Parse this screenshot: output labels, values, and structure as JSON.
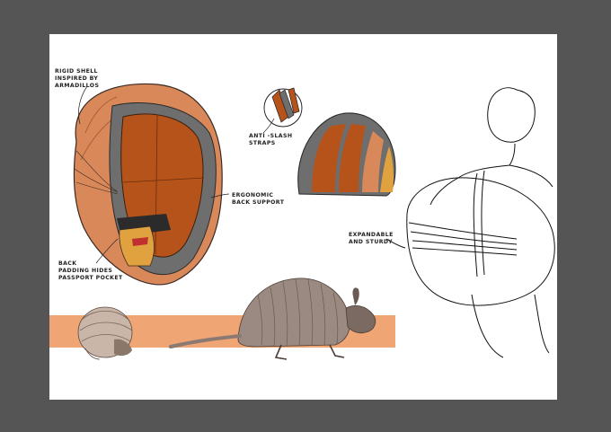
{
  "annotations": {
    "rigid_shell": [
      "RIGID SHELL",
      "INSPIRED BY",
      "ARMADILLOS"
    ],
    "anti_slash": [
      "ANTI -SLASH",
      "STRAPS"
    ],
    "ergonomic": [
      "ERGONOMIC",
      "BACK SUPPORT"
    ],
    "back_padding": [
      "BACK",
      "PADDING HIDES",
      "PASSPORT POCKET"
    ],
    "expandable": [
      "EXPANDABLE",
      "AND STURDY"
    ]
  },
  "colors": {
    "frame": "#555555",
    "paper": "#ffffff",
    "shell_tan": "#d9885a",
    "inner_brown": "#b5531a",
    "frame_grey": "#6e6e6e",
    "band_peach": "#f0a574",
    "armadillo": "#9a8a82"
  }
}
